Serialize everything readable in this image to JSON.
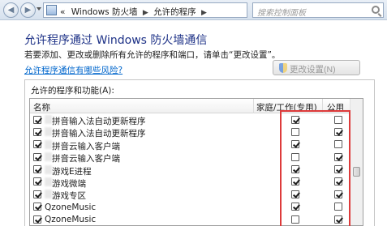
{
  "address_bar": {
    "breadcrumb_prefix": "«",
    "breadcrumbs": [
      "Windows 防火墙",
      "允许的程序"
    ],
    "search_placeholder": "搜索控制面板"
  },
  "page": {
    "title": "允许程序通过 Windows 防火墙通信",
    "description": "若要添加、更改或删除所有允许的程序和端口，请单击“更改设置”。",
    "risk_link": "允许程序通信有哪些风险?",
    "change_settings_button": "更改设置(N)",
    "list_label": "允许的程序和功能(A):"
  },
  "table": {
    "headers": {
      "name": "名称",
      "home_work": "家庭/工作(专用)",
      "public": "公用"
    },
    "rows": [
      {
        "enabled": true,
        "name": "拼音输入法自动更新程序",
        "home_work": true,
        "public": false
      },
      {
        "enabled": true,
        "name": "拼音输入法自动更新程序",
        "home_work": false,
        "public": true
      },
      {
        "enabled": true,
        "name": "拼音云输入客户端",
        "home_work": true,
        "public": false
      },
      {
        "enabled": true,
        "name": "拼音云输入客户端",
        "home_work": false,
        "public": true
      },
      {
        "enabled": true,
        "name": "游戏E进程",
        "home_work": true,
        "public": true
      },
      {
        "enabled": true,
        "name": "游戏微端",
        "home_work": true,
        "public": true
      },
      {
        "enabled": true,
        "name": "游戏专区",
        "home_work": true,
        "public": true
      },
      {
        "enabled": true,
        "name": "QzoneMusic",
        "home_work": true,
        "public": false
      },
      {
        "enabled": true,
        "name": "QzoneMusic",
        "home_work": false,
        "public": true
      }
    ]
  },
  "colors": {
    "title": "#1e3287",
    "link": "#0066cc",
    "highlight_box": "#dd3a3a"
  }
}
